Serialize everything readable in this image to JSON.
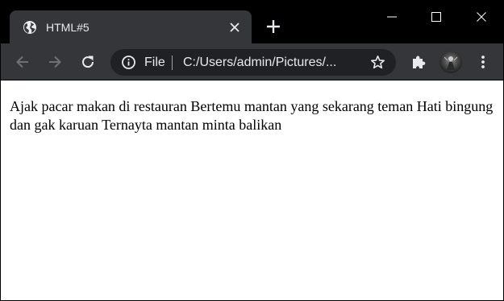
{
  "browser": {
    "tab": {
      "title": "HTML#5",
      "favicon": "globe-icon"
    },
    "address_bar": {
      "scheme_label": "File",
      "url": "C:/Users/admin/Pictures/..."
    },
    "icons": {
      "back": "arrow-left-icon",
      "forward": "arrow-right-icon",
      "reload": "reload-icon",
      "info": "info-icon",
      "star": "star-icon",
      "extensions": "puzzle-icon",
      "menu": "kebab-menu-icon"
    },
    "colors": {
      "tabstrip": "#000000",
      "toolbar": "#35363a",
      "omnibox": "#202124",
      "text": "#e8eaed"
    }
  },
  "page": {
    "text": "Ajak pacar makan di restauran Bertemu mantan yang sekarang teman Hati bingung dan gak karuan Ternayta mantan minta balikan"
  }
}
